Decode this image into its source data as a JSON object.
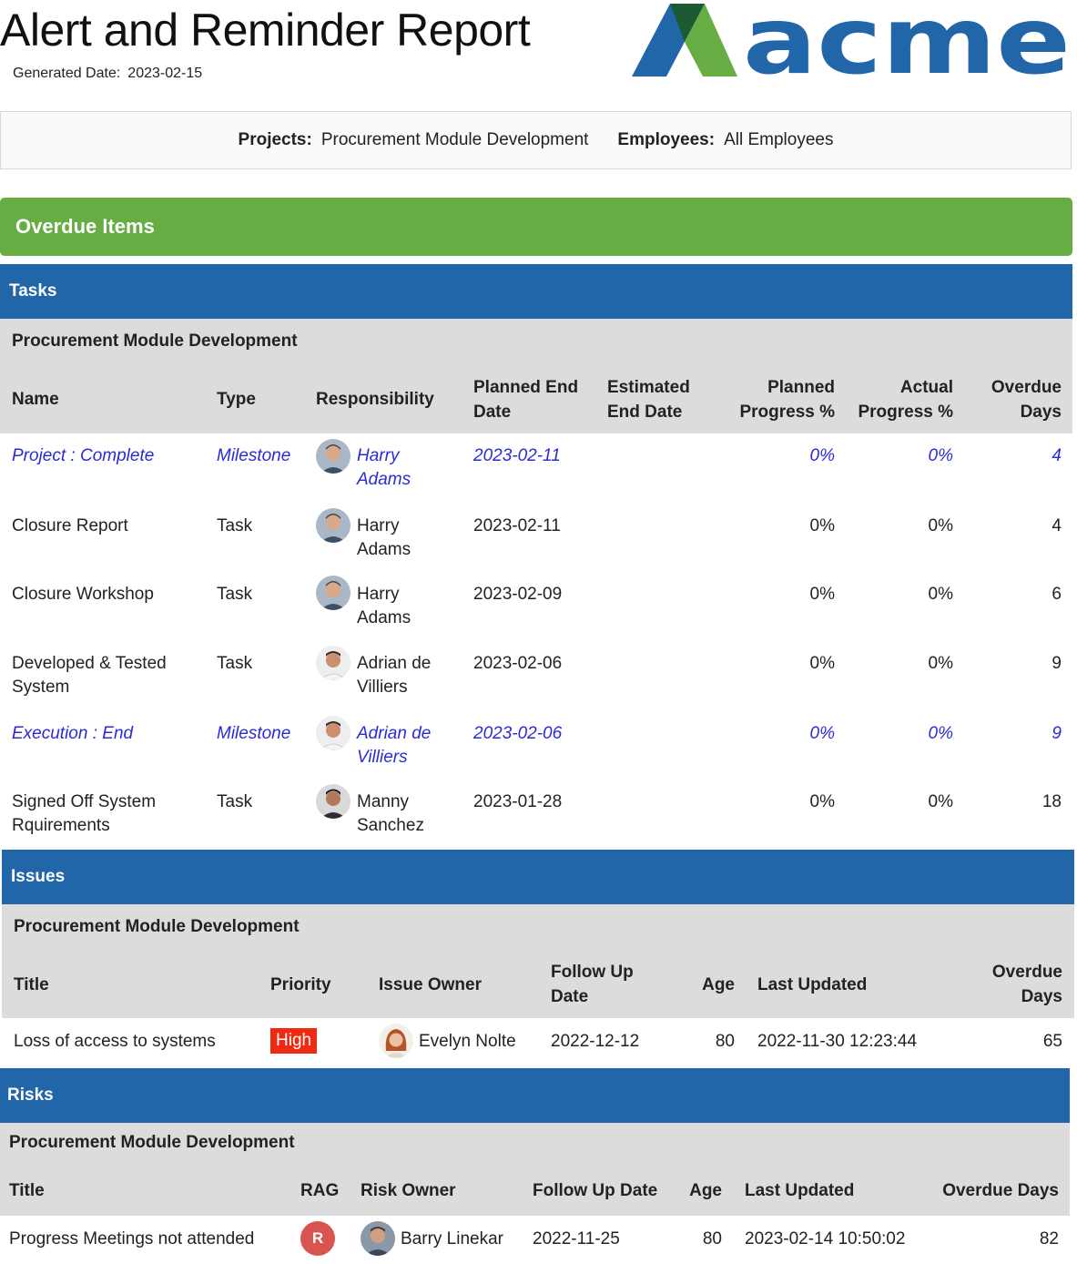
{
  "report": {
    "title": "Alert and Reminder Report",
    "generated_label": "Generated Date:",
    "generated_date": "2023-02-15",
    "logo_text": "acme"
  },
  "filters": {
    "projects_label": "Projects:",
    "projects_value": "Procurement Module Development",
    "employees_label": "Employees:",
    "employees_value": "All Employees"
  },
  "overdue_heading": "Overdue Items",
  "tasks": {
    "heading": "Tasks",
    "project": "Procurement Module Development",
    "columns": {
      "name": "Name",
      "type": "Type",
      "responsibility": "Responsibility",
      "planned_end_1": "Planned End",
      "planned_end_2": "Date",
      "estimated_end_1": "Estimated",
      "estimated_end_2": "End Date",
      "planned_progress_1": "Planned",
      "planned_progress_2": "Progress %",
      "actual_progress_1": "Actual",
      "actual_progress_2": "Progress %",
      "overdue_1": "Overdue",
      "overdue_2": "Days"
    },
    "rows": [
      {
        "name_1": "Project : Complete",
        "name_2": "",
        "type": "Milestone",
        "resp_1": "Harry",
        "resp_2": "Adams",
        "planned_end": "2023-02-11",
        "estimated_end": "",
        "planned_progress": "0%",
        "actual_progress": "0%",
        "overdue_days": "4",
        "avatar": "harry-avatar"
      },
      {
        "name_1": "Closure Report",
        "name_2": "",
        "type": "Task",
        "resp_1": "Harry",
        "resp_2": "Adams",
        "planned_end": "2023-02-11",
        "estimated_end": "",
        "planned_progress": "0%",
        "actual_progress": "0%",
        "overdue_days": "4",
        "avatar": "harry-avatar"
      },
      {
        "name_1": "Closure Workshop",
        "name_2": "",
        "type": "Task",
        "resp_1": "Harry",
        "resp_2": "Adams",
        "planned_end": "2023-02-09",
        "estimated_end": "",
        "planned_progress": "0%",
        "actual_progress": "0%",
        "overdue_days": "6",
        "avatar": "harry-avatar"
      },
      {
        "name_1": "Developed & Tested",
        "name_2": "System",
        "type": "Task",
        "resp_1": "Adrian de",
        "resp_2": "Villiers",
        "planned_end": "2023-02-06",
        "estimated_end": "",
        "planned_progress": "0%",
        "actual_progress": "0%",
        "overdue_days": "9",
        "avatar": "adrian-avatar"
      },
      {
        "name_1": "Execution : End",
        "name_2": "",
        "type": "Milestone",
        "resp_1": "Adrian de",
        "resp_2": "Villiers",
        "planned_end": "2023-02-06",
        "estimated_end": "",
        "planned_progress": "0%",
        "actual_progress": "0%",
        "overdue_days": "9",
        "avatar": "adrian-avatar"
      },
      {
        "name_1": "Signed Off System",
        "name_2": "Rquirements",
        "type": "Task",
        "resp_1": "Manny",
        "resp_2": "Sanchez",
        "planned_end": "2023-01-28",
        "estimated_end": "",
        "planned_progress": "0%",
        "actual_progress": "0%",
        "overdue_days": "18",
        "avatar": "manny-avatar"
      }
    ]
  },
  "issues": {
    "heading": "Issues",
    "project": "Procurement Module Development",
    "columns": {
      "title": "Title",
      "priority": "Priority",
      "owner": "Issue Owner",
      "follow_1": "Follow Up",
      "follow_2": "Date",
      "age": "Age",
      "last_updated": "Last Updated",
      "overdue_1": "Overdue",
      "overdue_2": "Days"
    },
    "rows": [
      {
        "title": "Loss of access to systems",
        "priority": "High",
        "owner": "Evelyn Nolte",
        "follow_up": "2022-12-12",
        "age": "80",
        "last_updated": "2022-11-30 12:23:44",
        "overdue_days": "65",
        "priority_color": "#ee2a12"
      }
    ]
  },
  "risks": {
    "heading": "Risks",
    "project": "Procurement Module Development",
    "columns": {
      "title": "Title",
      "rag": "RAG",
      "owner": "Risk Owner",
      "follow_up": "Follow Up Date",
      "age": "Age",
      "last_updated": "Last Updated",
      "overdue": "Overdue Days"
    },
    "rows": [
      {
        "title": "Progress Meetings not attended",
        "rag": "R",
        "owner": "Barry Linekar",
        "follow_up": "2022-11-25",
        "age": "80",
        "last_updated": "2023-02-14 10:50:02",
        "overdue_days": "82",
        "rag_color": "#d9534f"
      }
    ]
  },
  "colors": {
    "section_blue": "#2166a9",
    "overdue_green": "#67ad43",
    "milestone_text": "#2b2bd6",
    "logo_blue": "#2166a9",
    "logo_green": "#67ad43",
    "logo_dark_green": "#1d5a33"
  }
}
